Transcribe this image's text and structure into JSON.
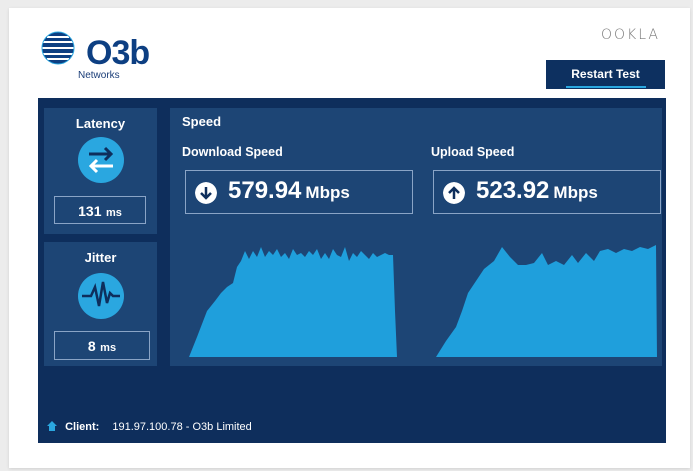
{
  "brand": {
    "logo_text": "O3b",
    "logo_sub": "Networks",
    "partner": "OOKLA"
  },
  "toolbar": {
    "restart_label": "Restart Test"
  },
  "latency": {
    "title": "Latency",
    "value": "131",
    "unit": "ms",
    "icon": "bidirectional-arrows-icon"
  },
  "jitter": {
    "title": "Jitter",
    "value": "8",
    "unit": "ms",
    "icon": "heartbeat-wave-icon"
  },
  "speed": {
    "title": "Speed",
    "download": {
      "label": "Download Speed",
      "value": "579.94",
      "unit": "Mbps",
      "icon": "down-arrow-icon"
    },
    "upload": {
      "label": "Upload Speed",
      "value": "523.92",
      "unit": "Mbps",
      "icon": "up-arrow-icon"
    }
  },
  "client": {
    "label": "Client:",
    "value": "191.97.100.78 - O3b Limited",
    "icon": "home-icon"
  },
  "colors": {
    "panel_bg": "#0e2e5c",
    "box_bg": "#1d4575",
    "accent": "#2aa7e0",
    "button_bg": "#0d3060"
  }
}
